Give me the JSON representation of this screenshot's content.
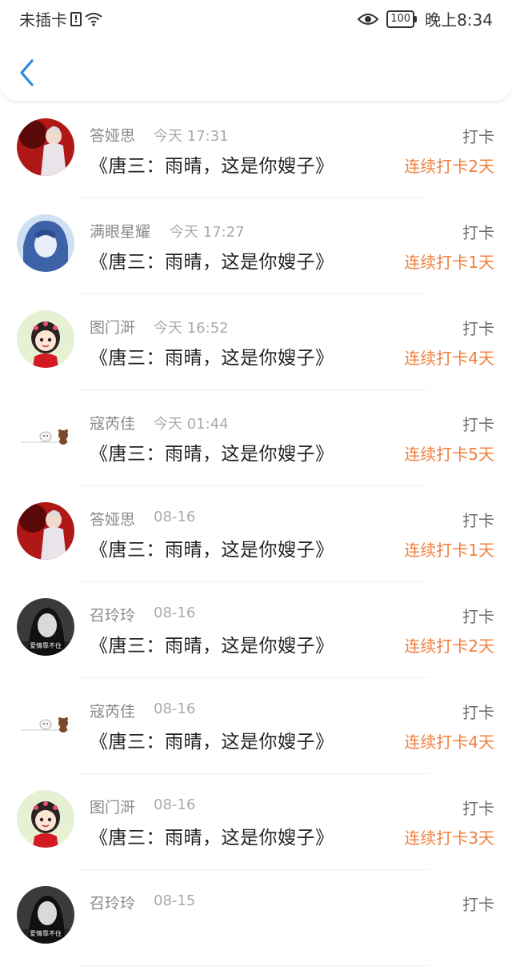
{
  "status_bar": {
    "carrier": "未插卡",
    "battery": "100",
    "time": "晚上8:34"
  },
  "nav": {
    "back_icon": "chevron-left-icon"
  },
  "colors": {
    "accent": "#2a8cdc",
    "streak": "#f0803c"
  },
  "items": [
    {
      "name": "答娅思",
      "time": "今天 17:31",
      "title": "《唐三：雨晴，这是你嫂子》",
      "tag": "打卡",
      "streak": "连续打卡2天",
      "avatar": "avatar-red"
    },
    {
      "name": "满眼星耀",
      "time": "今天 17:27",
      "title": "《唐三：雨晴，这是你嫂子》",
      "tag": "打卡",
      "streak": "连续打卡1天",
      "avatar": "avatar-blue"
    },
    {
      "name": "图门涆",
      "time": "今天 16:52",
      "title": "《唐三：雨晴，这是你嫂子》",
      "tag": "打卡",
      "streak": "连续打卡4天",
      "avatar": "avatar-girl"
    },
    {
      "name": "寇芮佳",
      "time": "今天 01:44",
      "title": "《唐三：雨晴，这是你嫂子》",
      "tag": "打卡",
      "streak": "连续打卡5天",
      "avatar": "avatar-bears"
    },
    {
      "name": "答娅思",
      "time": "08-16",
      "title": "《唐三：雨晴，这是你嫂子》",
      "tag": "打卡",
      "streak": "连续打卡1天",
      "avatar": "avatar-red"
    },
    {
      "name": "召玲玲",
      "time": "08-16",
      "title": "《唐三：雨晴，这是你嫂子》",
      "tag": "打卡",
      "streak": "连续打卡2天",
      "avatar": "avatar-bw"
    },
    {
      "name": "寇芮佳",
      "time": "08-16",
      "title": "《唐三：雨晴，这是你嫂子》",
      "tag": "打卡",
      "streak": "连续打卡4天",
      "avatar": "avatar-bears"
    },
    {
      "name": "图门涆",
      "time": "08-16",
      "title": "《唐三：雨晴，这是你嫂子》",
      "tag": "打卡",
      "streak": "连续打卡3天",
      "avatar": "avatar-girl"
    },
    {
      "name": "召玲玲",
      "time": "08-15",
      "title": "",
      "tag": "打卡",
      "streak": "",
      "avatar": "avatar-bw"
    }
  ]
}
